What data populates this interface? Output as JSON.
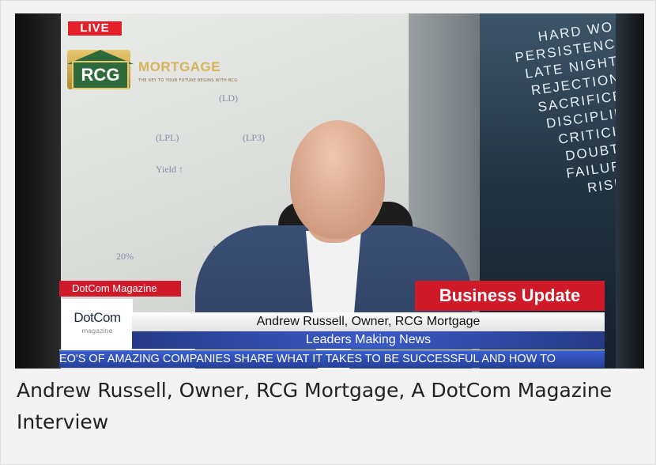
{
  "video": {
    "live_badge": "LIVE",
    "logo": {
      "mark_text": "RCG",
      "brand_text": "MORTGAGE",
      "tagline": "THE KEY TO YOUR FUTURE BEGINS WITH RCG"
    },
    "mural_words": [
      "HARD WO",
      "PERSISTENC",
      "LATE NIGHT",
      "REJECTION",
      "SACRIFICE",
      "DISCIPLIN",
      "CRITICIS",
      "DOUBTS",
      "FAILURE",
      "RISKS"
    ],
    "lower_third": {
      "magazine_label": "DotCom Magazine",
      "business_update": "Business Update",
      "logo_main": "DotCom",
      "logo_sub": "magazine",
      "name_line": "Andrew Russell, Owner, RCG Mortgage",
      "leaders_line": "Leaders Making News",
      "ticker": "EO'S OF AMAZING COMPANIES SHARE WHAT IT TAKES TO BE SUCCESSFUL AND HOW TO"
    }
  },
  "caption": "Andrew Russell, Owner, RCG Mortgage, A DotCom Magazine Interview",
  "colors": {
    "live_red": "#e4212b",
    "accent_red": "#d01a2a",
    "ticker_blue": "#3b5fd0",
    "logo_green": "#2f6b3a",
    "logo_gold": "#d9b35a"
  }
}
